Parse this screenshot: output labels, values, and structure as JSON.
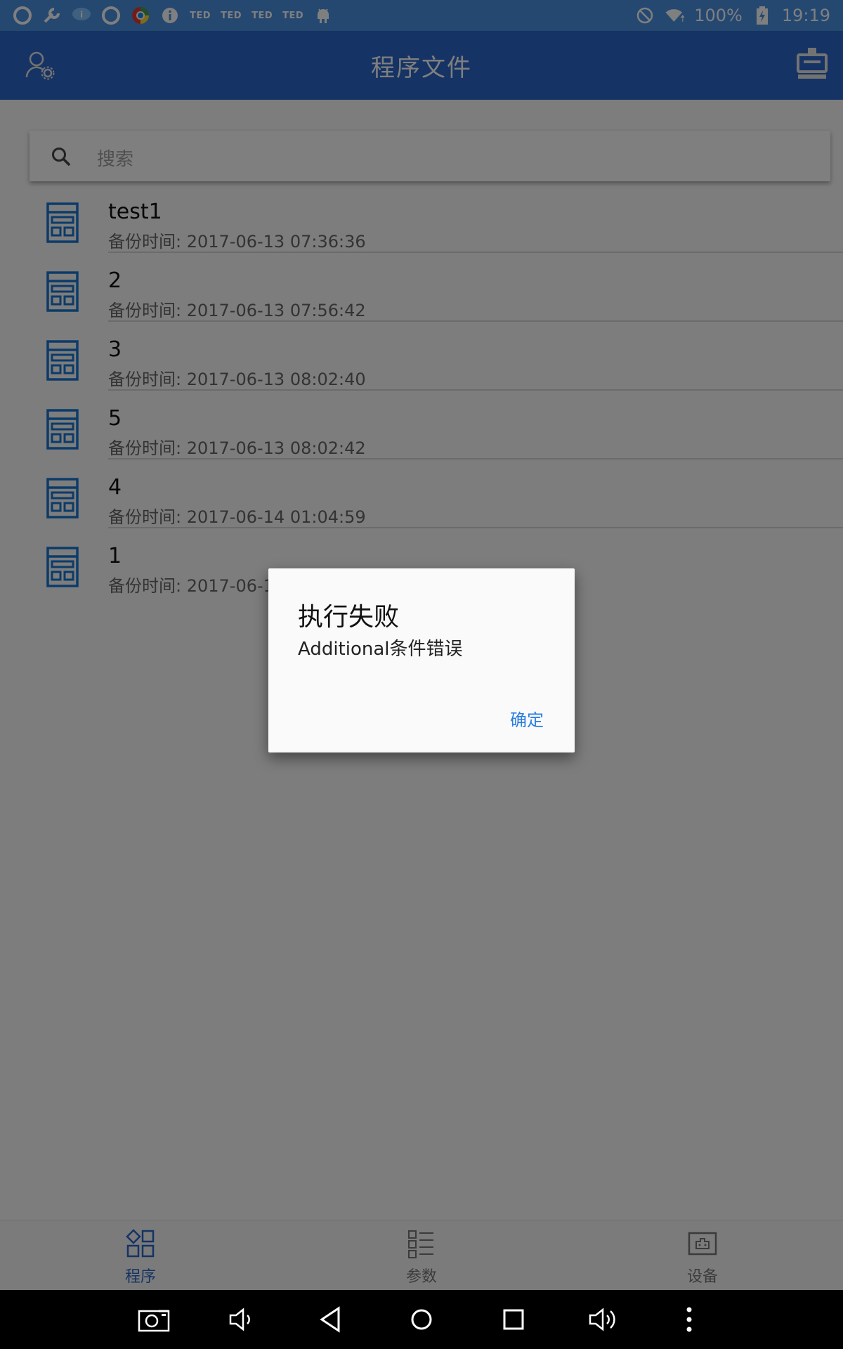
{
  "status_bar": {
    "ted_badges": [
      "TED",
      "TED",
      "TED",
      "TED"
    ],
    "battery": "100%",
    "time": "19:19"
  },
  "app_bar": {
    "title": "程序文件"
  },
  "search": {
    "placeholder": "搜索"
  },
  "files": [
    {
      "name": "test1",
      "time": "备份时间: 2017-06-13 07:36:36"
    },
    {
      "name": "2",
      "time": "备份时间: 2017-06-13 07:56:42"
    },
    {
      "name": "3",
      "time": "备份时间: 2017-06-13 08:02:40"
    },
    {
      "name": "5",
      "time": "备份时间: 2017-06-13 08:02:42"
    },
    {
      "name": "4",
      "time": "备份时间: 2017-06-14 01:04:59"
    },
    {
      "name": "1",
      "time": "备份时间: 2017-06-1"
    }
  ],
  "bottom_nav": {
    "items": [
      {
        "label": "程序",
        "icon": "program-icon",
        "active": true
      },
      {
        "label": "参数",
        "icon": "params-list-icon",
        "active": false
      },
      {
        "label": "设备",
        "icon": "device-icon",
        "active": false
      }
    ]
  },
  "dialog": {
    "title": "执行失败",
    "message": "Additional条件错误",
    "ok_label": "确定"
  },
  "colors": {
    "status_bar": "#4a90e2",
    "app_bar": "#2a67c9",
    "accent": "#2a7de1"
  }
}
